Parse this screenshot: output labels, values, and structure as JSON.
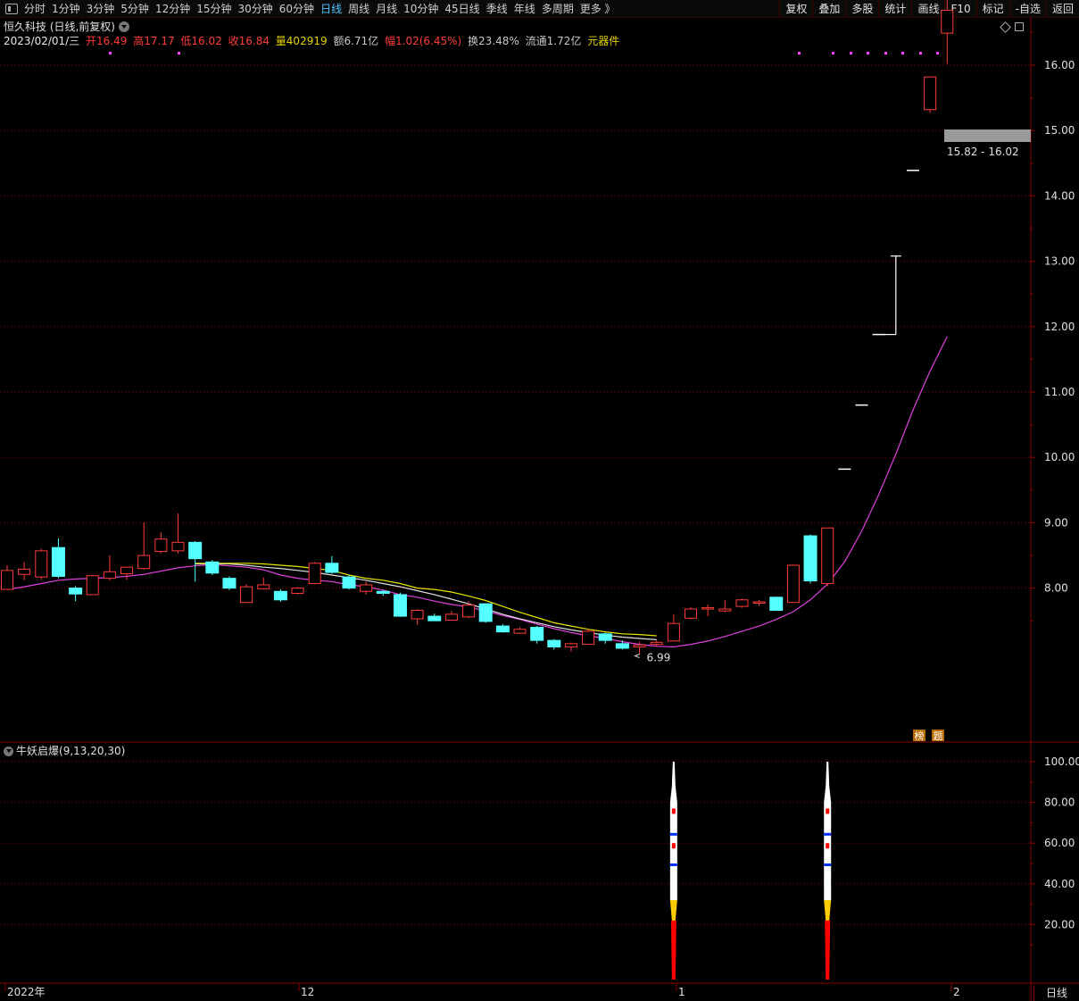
{
  "toolbar": {
    "periods": [
      "分时",
      "1分钟",
      "3分钟",
      "5分钟",
      "12分钟",
      "15分钟",
      "30分钟",
      "60分钟",
      "日线",
      "周线",
      "月线",
      "10分钟",
      "45日线",
      "季线",
      "年线",
      "多周期",
      "更多 》"
    ],
    "active_period": "日线",
    "tools": [
      "复权",
      "叠加",
      "多股",
      "统计",
      "画线",
      "F10",
      "标记",
      "-自选",
      "返回"
    ]
  },
  "stock": {
    "title": "恒久科技 (日线,前复权)"
  },
  "quote": {
    "date": "2023/02/01/三",
    "open": "开16.49",
    "high": "高17.17",
    "low": "低16.02",
    "close": "收16.84",
    "volume": "量402919",
    "amount": "额6.71亿",
    "change": "幅1.02(6.45%)",
    "turnover": "换23.48%",
    "float_cap": "流通1.72亿",
    "sector": "元器件"
  },
  "colors": {
    "up": "#ff3b3b",
    "down": "#54ffff",
    "grid": "#8a0000",
    "ma_pink": "#e040e0",
    "ma_yellow": "#e6e600",
    "ma_white": "#e0e0e0"
  },
  "annotations": {
    "high_label": "17.17",
    "low_label": "6.99",
    "range_label": "15.82 - 16.02",
    "badge_1": "榜",
    "badge_2": "题"
  },
  "indicator": {
    "name": "牛妖启爆",
    "params": "(9,13,20,30)",
    "ticks": [
      "100.00",
      "80.00",
      "60.00",
      "40.00",
      "20.00"
    ]
  },
  "time_axis": {
    "labels": [
      "2022年",
      "12",
      "1",
      "2"
    ],
    "period_label": "日线"
  },
  "chart_data": {
    "type": "candlestick",
    "title": "恒久科技 (日线,前复权)",
    "y_ticks": [
      16.0,
      15.0,
      14.0,
      13.0,
      12.0,
      11.0,
      10.0,
      9.0,
      8.0
    ],
    "ylim": [
      6.9,
      17.3
    ],
    "candles": [
      {
        "o": 7.98,
        "h": 8.35,
        "l": 7.98,
        "c": 8.27
      },
      {
        "o": 8.21,
        "h": 8.4,
        "l": 8.12,
        "c": 8.29
      },
      {
        "o": 8.17,
        "h": 8.6,
        "l": 8.13,
        "c": 8.57
      },
      {
        "o": 8.62,
        "h": 8.76,
        "l": 8.15,
        "c": 8.18
      },
      {
        "o": 8.0,
        "h": 8.03,
        "l": 7.8,
        "c": 7.91
      },
      {
        "o": 7.9,
        "h": 8.2,
        "l": 7.9,
        "c": 8.19
      },
      {
        "o": 8.15,
        "h": 8.5,
        "l": 8.12,
        "c": 8.25
      },
      {
        "o": 8.22,
        "h": 8.33,
        "l": 8.13,
        "c": 8.32
      },
      {
        "o": 8.3,
        "h": 9.0,
        "l": 8.28,
        "c": 8.5
      },
      {
        "o": 8.56,
        "h": 8.85,
        "l": 8.53,
        "c": 8.75
      },
      {
        "o": 8.57,
        "h": 9.14,
        "l": 8.53,
        "c": 8.7
      },
      {
        "o": 8.7,
        "h": 8.72,
        "l": 8.1,
        "c": 8.45
      },
      {
        "o": 8.4,
        "h": 8.43,
        "l": 8.2,
        "c": 8.23
      },
      {
        "o": 8.15,
        "h": 8.18,
        "l": 7.97,
        "c": 8.0
      },
      {
        "o": 7.78,
        "h": 8.06,
        "l": 7.78,
        "c": 8.02
      },
      {
        "o": 7.99,
        "h": 8.16,
        "l": 7.98,
        "c": 8.05
      },
      {
        "o": 7.95,
        "h": 7.98,
        "l": 7.79,
        "c": 7.82
      },
      {
        "o": 7.92,
        "h": 8.02,
        "l": 7.9,
        "c": 8.0
      },
      {
        "o": 8.07,
        "h": 8.4,
        "l": 8.06,
        "c": 8.38
      },
      {
        "o": 8.38,
        "h": 8.49,
        "l": 8.22,
        "c": 8.24
      },
      {
        "o": 8.17,
        "h": 8.2,
        "l": 7.98,
        "c": 8.0
      },
      {
        "o": 7.95,
        "h": 8.1,
        "l": 7.9,
        "c": 8.05
      },
      {
        "o": 7.95,
        "h": 7.97,
        "l": 7.88,
        "c": 7.92
      },
      {
        "o": 7.9,
        "h": 7.93,
        "l": 7.56,
        "c": 7.57
      },
      {
        "o": 7.53,
        "h": 7.68,
        "l": 7.44,
        "c": 7.66
      },
      {
        "o": 7.57,
        "h": 7.61,
        "l": 7.53,
        "c": 7.5
      },
      {
        "o": 7.51,
        "h": 7.65,
        "l": 7.51,
        "c": 7.6
      },
      {
        "o": 7.56,
        "h": 7.8,
        "l": 7.54,
        "c": 7.74
      },
      {
        "o": 7.76,
        "h": 7.77,
        "l": 7.47,
        "c": 7.49
      },
      {
        "o": 7.42,
        "h": 7.45,
        "l": 7.32,
        "c": 7.33
      },
      {
        "o": 7.31,
        "h": 7.4,
        "l": 7.3,
        "c": 7.37
      },
      {
        "o": 7.4,
        "h": 7.42,
        "l": 7.15,
        "c": 7.2
      },
      {
        "o": 7.2,
        "h": 7.22,
        "l": 7.06,
        "c": 7.1
      },
      {
        "o": 7.1,
        "h": 7.17,
        "l": 7.03,
        "c": 7.15
      },
      {
        "o": 7.14,
        "h": 7.38,
        "l": 7.14,
        "c": 7.34
      },
      {
        "o": 7.3,
        "h": 7.32,
        "l": 7.15,
        "c": 7.2
      },
      {
        "o": 7.15,
        "h": 7.2,
        "l": 7.06,
        "c": 7.08
      },
      {
        "o": 7.1,
        "h": 7.18,
        "l": 6.99,
        "c": 7.13
      },
      {
        "o": 7.14,
        "h": 7.2,
        "l": 7.1,
        "c": 7.17
      },
      {
        "o": 7.19,
        "h": 7.6,
        "l": 7.18,
        "c": 7.46
      },
      {
        "o": 7.54,
        "h": 7.71,
        "l": 7.52,
        "c": 7.68
      },
      {
        "o": 7.7,
        "h": 7.75,
        "l": 7.57,
        "c": 7.7
      },
      {
        "o": 7.65,
        "h": 7.82,
        "l": 7.63,
        "c": 7.68
      },
      {
        "o": 7.72,
        "h": 7.84,
        "l": 7.7,
        "c": 7.82
      },
      {
        "o": 7.78,
        "h": 7.82,
        "l": 7.73,
        "c": 7.79
      },
      {
        "o": 7.86,
        "h": 7.87,
        "l": 7.66,
        "c": 7.66
      },
      {
        "o": 7.78,
        "h": 8.36,
        "l": 7.78,
        "c": 8.35
      },
      {
        "o": 8.8,
        "h": 8.82,
        "l": 8.07,
        "c": 8.11
      },
      {
        "o": 8.07,
        "h": 8.92,
        "l": 8.03,
        "c": 8.92
      },
      {
        "o": 9.82,
        "h": 9.82,
        "l": 9.82,
        "c": 9.82
      },
      {
        "o": 10.8,
        "h": 10.8,
        "l": 10.8,
        "c": 10.8
      },
      {
        "o": 11.88,
        "h": 11.88,
        "l": 11.88,
        "c": 11.88
      },
      {
        "o": 11.88,
        "h": 13.08,
        "l": 11.88,
        "c": 13.08
      },
      {
        "o": 14.39,
        "h": 14.39,
        "l": 14.39,
        "c": 14.39
      },
      {
        "o": 15.32,
        "h": 15.82,
        "l": 15.27,
        "c": 15.82
      },
      {
        "o": 16.49,
        "h": 17.17,
        "l": 16.02,
        "c": 16.84
      }
    ],
    "ma_series": [
      {
        "color": "#e040e0",
        "values": [
          7.98,
          8.02,
          8.07,
          8.12,
          8.14,
          8.15,
          8.16,
          8.18,
          8.21,
          8.26,
          8.31,
          8.34,
          8.36,
          8.34,
          8.32,
          8.28,
          8.2,
          8.15,
          8.12,
          8.1,
          8.05,
          8.02,
          7.97,
          7.9,
          7.86,
          7.8,
          7.75,
          7.71,
          7.65,
          7.58,
          7.52,
          7.45,
          7.38,
          7.32,
          7.27,
          7.23,
          7.18,
          7.14,
          7.11,
          7.1,
          7.14,
          7.19,
          7.26,
          7.34,
          7.42,
          7.52,
          7.64,
          7.82,
          8.06,
          8.4,
          8.87,
          9.43,
          10.05,
          10.72,
          11.32,
          11.85
        ]
      },
      {
        "color": "#e0e0e0",
        "start": 11,
        "values": [
          8.37,
          8.37,
          8.37,
          8.35,
          8.32,
          8.3,
          8.27,
          8.24,
          8.2,
          8.16,
          8.12,
          8.07,
          8.02,
          7.96,
          7.9,
          7.83,
          7.76,
          7.68,
          7.6,
          7.53,
          7.47,
          7.41,
          7.36,
          7.32,
          7.28,
          7.25,
          7.23,
          7.21
        ]
      },
      {
        "color": "#e6e600",
        "start": 11,
        "values": [
          8.38,
          8.38,
          8.38,
          8.38,
          8.37,
          8.35,
          8.33,
          8.3,
          8.27,
          8.2,
          8.15,
          8.12,
          8.07,
          8.0,
          7.98,
          7.94,
          7.88,
          7.81,
          7.72,
          7.63,
          7.55,
          7.47,
          7.42,
          7.37,
          7.33,
          7.3,
          7.29,
          7.27
        ]
      }
    ],
    "indicator_bars": [
      {
        "index": 39,
        "top": 100
      },
      {
        "index": 48,
        "top": 100
      }
    ],
    "x_labels": [
      "2022年",
      "12",
      "1",
      "2"
    ]
  }
}
